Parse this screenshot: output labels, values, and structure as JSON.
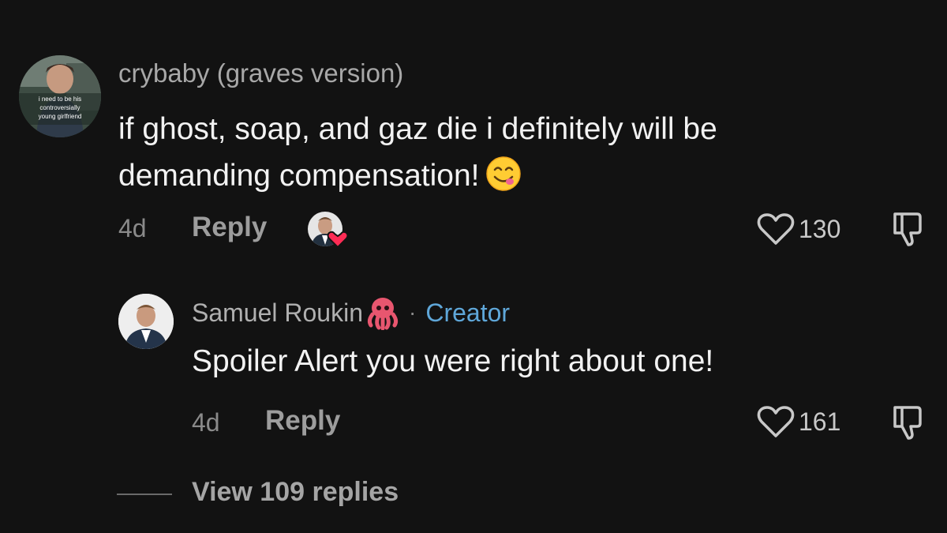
{
  "comment": {
    "username": "crybaby (graves version)",
    "avatar_caption": "i need to be his controversially young girlfriend",
    "text": "if ghost, soap, and gaz die i definitely will be demanding compensation!",
    "emoji": "smiling-face-savoring-food",
    "time": "4d",
    "reply_label": "Reply",
    "likes": "130"
  },
  "reply": {
    "username": "Samuel Roukin",
    "emoji": "octopus",
    "separator": "·",
    "badge": "Creator",
    "text": "Spoiler Alert you were right about one!",
    "time": "4d",
    "reply_label": "Reply",
    "likes": "161"
  },
  "view_replies": "View 109 replies",
  "colors": {
    "background": "#121212",
    "creator_badge": "#5fa7d9",
    "heart_badge": "#fe2c55"
  }
}
